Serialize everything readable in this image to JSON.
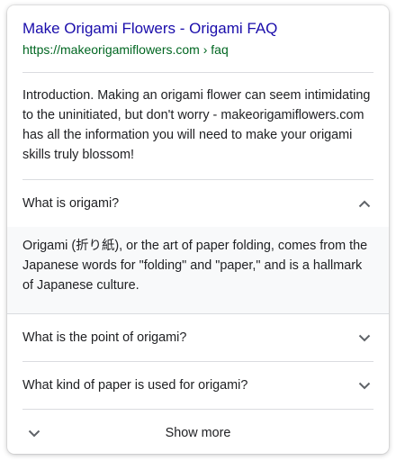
{
  "result": {
    "title": "Make Origami Flowers - Origami FAQ",
    "url": "https://makeorigamiflowers.com › faq",
    "snippet": "Introduction. Making an origami flower can seem intimidating to the uninitiated, but don't worry - makeorigamiflowers.com has all the information you will need to make your origami skills truly blossom!"
  },
  "faq": {
    "items": [
      {
        "question": "What is origami?",
        "expanded": true,
        "answer": "Origami (折り紙), or the art of paper folding, comes from the Japanese words for \"folding\" and \"paper,\" and is a hallmark of Japanese culture."
      },
      {
        "question": "What is the point of origami?",
        "expanded": false
      },
      {
        "question": "What kind of paper is used for origami?",
        "expanded": false
      }
    ],
    "show_more_label": "Show more"
  },
  "icons": {
    "expanded": "chevron-up-icon",
    "collapsed": "chevron-down-icon"
  },
  "colors": {
    "title_link": "#1a0dab",
    "url": "#006621",
    "text": "#202124",
    "answer_background": "#f8f9fa",
    "divider": "#dadce0"
  }
}
